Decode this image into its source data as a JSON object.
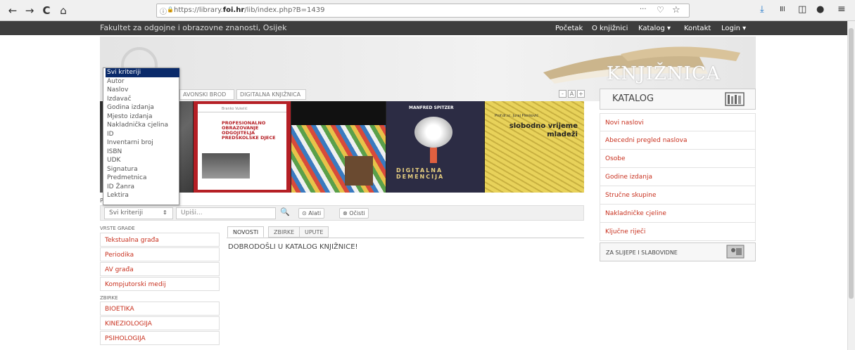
{
  "browser": {
    "url_prefix": "https://library.",
    "url_domain": "foi.hr",
    "url_suffix": "/lib/index.php?B=1439",
    "back_icon": "←",
    "forward_icon": "→",
    "reload_icon": "C",
    "home_icon": "⌂",
    "info_icon": "ⓘ",
    "lock_icon": "🔒",
    "more_icon": "···",
    "pocket_icon": "♡",
    "star_icon": "☆",
    "download_icon": "⤓",
    "library_icon": "ⅡⅠ",
    "sidebar_icon": "◫",
    "account_icon": "●",
    "menu_icon": "≡"
  },
  "site": {
    "title": "Fakultet za odgojne i obrazovne znanosti, Osijek",
    "nav": [
      "Početak",
      "O knjižnici",
      "Katalog ▾",
      "Kontakt",
      "Login ▾"
    ],
    "banner_text": "KNJIŽNICA"
  },
  "top_tabs": [
    "AVONSKI BROD",
    "DIGITALNA KNJIŽNICA"
  ],
  "font_controls": [
    "-",
    "A",
    "+"
  ],
  "slider": {
    "book1_author": "Branko Vukelić",
    "book1_title": "PROFESIONALNO OBRAZOVANJE ODGOJITELJA PREDŠKOLSKE DJECE",
    "book3_author": "MANFRED SPITZER",
    "book3_title": "DIGITALNA DEMENCIJA",
    "book4_author": "Prof.dr.sc. Juraj Plenković",
    "book4_title": "slobodno vrijeme mladeži"
  },
  "dropdown": {
    "options": [
      "Svi kriteriji",
      "Autor",
      "Naslov",
      "Izdavač",
      "Godina izdanja",
      "Mjesto izdanja",
      "Nakladnička cjelina",
      "ID",
      "Inventarni broj",
      "ISBN",
      "UDK",
      "Signatura",
      "Predmetnica",
      "ID Žanra",
      "Lektira"
    ],
    "selected": "Svi kriteriji"
  },
  "search": {
    "label_fragment": "P",
    "criteria": "Svi kriteriji",
    "placeholder": "Upiši...",
    "search_icon": "🔍",
    "tools_label": "Alati",
    "clear_label": "Očisti"
  },
  "sidebar": {
    "vrste_head": "VRSTE GRAĐE",
    "vrste": [
      "Tekstualna građa",
      "Periodika",
      "AV građa",
      "Kompjutorski medij"
    ],
    "zbirke_head": "ZBIRKE",
    "zbirke": [
      "BIOETIKA",
      "KINEZIOLOGIJA",
      "PSIHOLOGIJA"
    ]
  },
  "center": {
    "tabs": [
      "NOVOSTI",
      "ZBIRKE",
      "UPUTE"
    ],
    "welcome": "DOBRODOŠLI U KATALOG KNJIŽNICE!"
  },
  "catalog": {
    "title": "KATALOG",
    "items": [
      "Novi naslovi",
      "Abecedni pregled naslova",
      "Osobe",
      "Godine izdanja",
      "Stručne skupine",
      "Nakladničke cjeline",
      "Ključne riječi"
    ],
    "slijepe": "ZA SLIJEPE I SLABOVIDNE"
  },
  "colors": {
    "accent_red": "#c8301e",
    "navbar": "#3d3d3d",
    "dropdown_selected": "#0a2a6a"
  }
}
